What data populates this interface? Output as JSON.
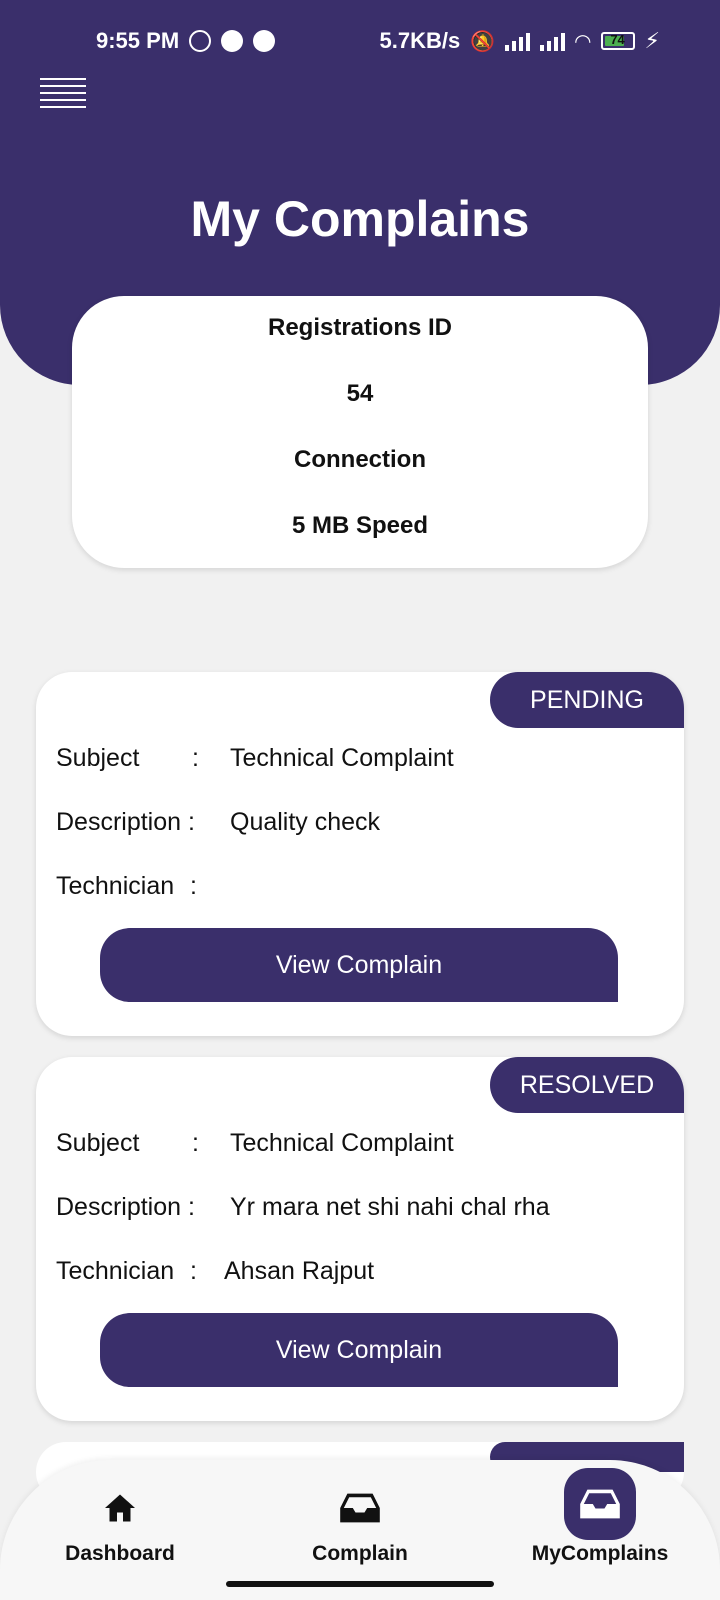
{
  "status_bar": {
    "time": "9:55 PM",
    "speed": "5.7KB/s",
    "battery": "74",
    "battery_level": 0.74
  },
  "header": {
    "title": "My Complains"
  },
  "info_card": {
    "label1": "Registrations ID",
    "value1": "54",
    "label2": "Connection",
    "value2": "5 MB Speed"
  },
  "complaints": [
    {
      "status": "PENDING",
      "subject_label": "Subject",
      "subject": "Technical Complaint",
      "description_label": "Description :",
      "description": "Quality check",
      "technician_label": "Technician",
      "technician": "",
      "button": "View Complain"
    },
    {
      "status": "RESOLVED",
      "subject_label": "Subject",
      "subject": "Technical Complaint",
      "description_label": "Description :",
      "description": "Yr mara net shi nahi chal rha",
      "technician_label": "Technician",
      "technician": "Ahsan Rajput",
      "button": "View Complain"
    }
  ],
  "nav": {
    "items": [
      {
        "label": "Dashboard",
        "icon": "home-icon"
      },
      {
        "label": "Complain",
        "icon": "inbox-icon"
      },
      {
        "label": "MyComplains",
        "icon": "inbox-icon",
        "active": true
      }
    ]
  },
  "colors": {
    "primary": "#3a2f6b",
    "background": "#f1f1f1"
  }
}
